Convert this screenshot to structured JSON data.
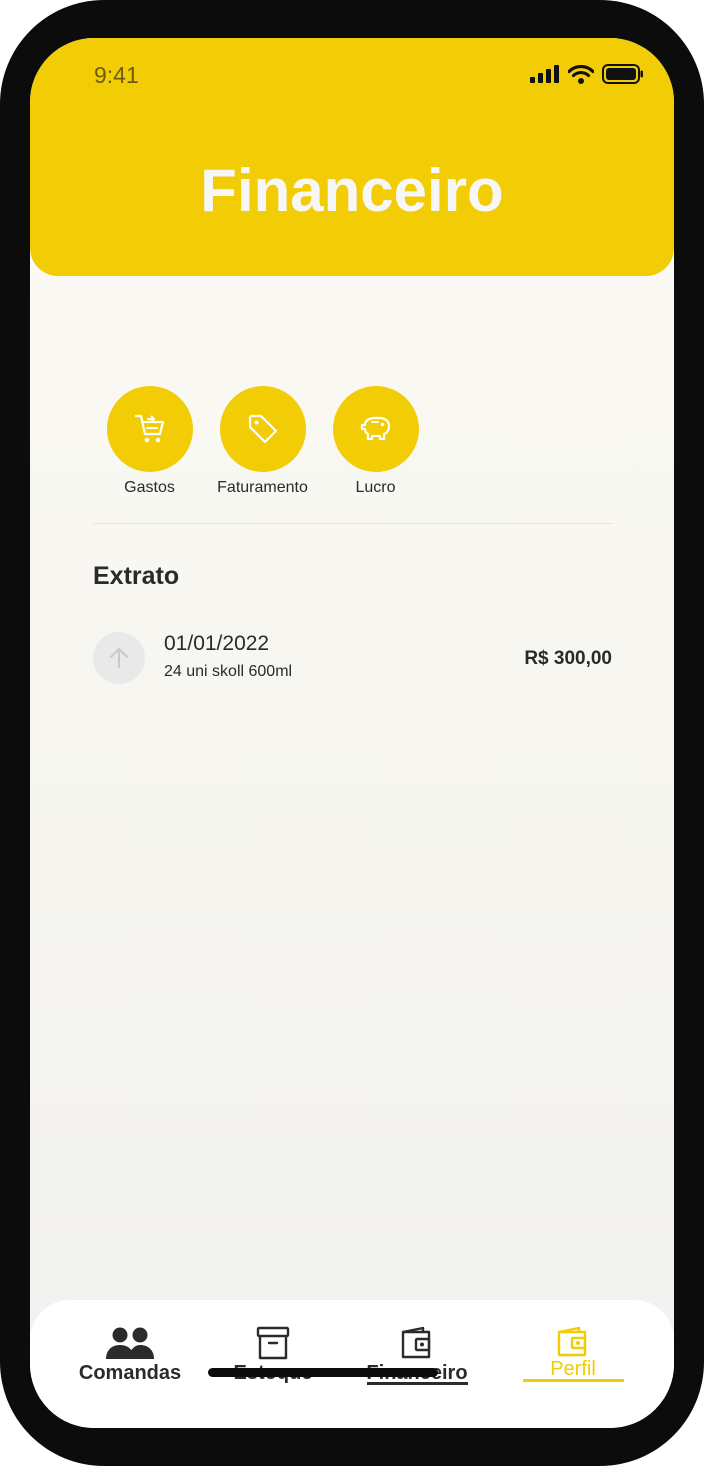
{
  "status_bar": {
    "time": "9:41"
  },
  "header": {
    "title": "Financeiro"
  },
  "quick_actions": [
    {
      "label": "Gastos",
      "icon": "cart-icon"
    },
    {
      "label": "Faturamento",
      "icon": "tag-icon"
    },
    {
      "label": "Lucro",
      "icon": "piggy-bank-icon"
    }
  ],
  "statement": {
    "title": "Extrato",
    "items": [
      {
        "date": "01/01/2022",
        "description": "24 uni skoll 600ml",
        "amount": "R$ 300,00",
        "icon": "arrow-up-icon"
      }
    ]
  },
  "bottom_nav": {
    "items": [
      {
        "label": "Comandas",
        "icon": "people-icon"
      },
      {
        "label": "Estoque",
        "icon": "archive-box-icon"
      },
      {
        "label": "Financeiro",
        "icon": "wallet-icon"
      },
      {
        "label": "Perfil",
        "icon": "wallet-icon",
        "active": true
      }
    ]
  },
  "colors": {
    "accent": "#f2cc05",
    "background": "#faf9f4",
    "text": "#2a2a2a",
    "frame": "#0c0c0c"
  }
}
